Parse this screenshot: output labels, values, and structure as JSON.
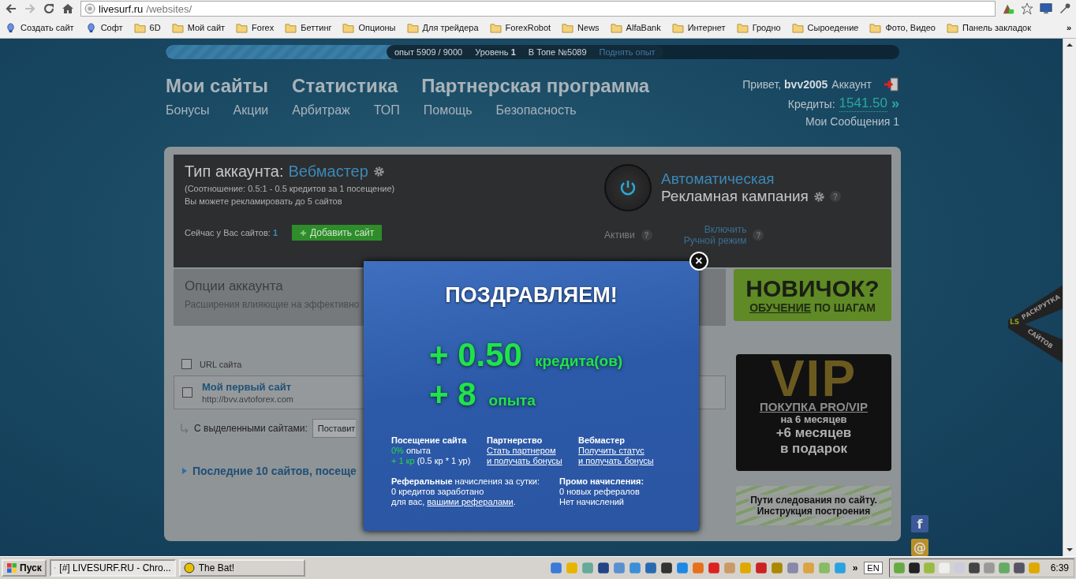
{
  "browser": {
    "url_host": "livesurf.ru",
    "url_path": "/websites/"
  },
  "bookmarks": [
    {
      "label": "Создать сайт",
      "kind": "page"
    },
    {
      "label": "Софт",
      "kind": "page"
    },
    {
      "label": "6D",
      "kind": "folder"
    },
    {
      "label": "Мой сайт",
      "kind": "folder"
    },
    {
      "label": "Forex",
      "kind": "folder"
    },
    {
      "label": "Беттинг",
      "kind": "folder"
    },
    {
      "label": "Опционы",
      "kind": "folder"
    },
    {
      "label": "Для трейдера",
      "kind": "folder"
    },
    {
      "label": "ForexRobot",
      "kind": "folder"
    },
    {
      "label": "News",
      "kind": "folder"
    },
    {
      "label": "AlfaBank",
      "kind": "folder"
    },
    {
      "label": "Интернет",
      "kind": "folder"
    },
    {
      "label": "Гродно",
      "kind": "folder"
    },
    {
      "label": "Сыроедение",
      "kind": "folder"
    },
    {
      "label": "Фото, Видео",
      "kind": "folder"
    },
    {
      "label": "Панель закладок",
      "kind": "folder"
    }
  ],
  "bookmarks_more": "»",
  "progress": {
    "level": 0.66,
    "experience": "опыт 5909 / 9000",
    "level_label": "Уровень",
    "level_value": "1",
    "rank": "В Топе №5089",
    "raise_link": "Поднять опыт"
  },
  "main_nav": [
    "Мои сайты",
    "Статистика",
    "Партнерская программа"
  ],
  "sub_nav": [
    "Бонусы",
    "Акции",
    "Арбитраж",
    "ТОП",
    "Помощь",
    "Безопасность"
  ],
  "user": {
    "greeting": "Привет,",
    "name": "bvv2005",
    "account_link": "Аккаунт",
    "credits_label": "Кредиты:",
    "credits": "1541.50",
    "credits_arrow": "»",
    "messages": "Мои Сообщения 1"
  },
  "account": {
    "type_label": "Тип аккаунта:",
    "type_value": "Вебмастер",
    "ratio": "(Соотношение: 0.5:1 - 0.5 кредитов за 1 посещение)",
    "limit": "Вы можете рекламировать до 5 сайтов",
    "sites_label": "Сейчас у Вас сайтов:",
    "sites_count": "1",
    "add_button": "Добавить сайт"
  },
  "campaign": {
    "title_1": "Автоматическая",
    "title_2": "Рекламная кампания",
    "auto_mode": "Активи",
    "manual_1": "Включить",
    "manual_2": "Ручной режим",
    "help_marks": [
      "?",
      "?",
      "?"
    ]
  },
  "options": {
    "title": "Опции аккаунта",
    "description": "Расширения влияющие на эффективно"
  },
  "sites_table": {
    "header": "URL сайта",
    "header_checked": false,
    "rows": [
      {
        "name": "Мой первый сайт",
        "url": "http://bvv.avtoforex.com",
        "checked": false
      }
    ],
    "bulk_label": "С выделенными сайтами:",
    "bulk_select": "Поставит"
  },
  "recent": "Последние 10 сайтов, посеще",
  "ads": {
    "novice_title": "НОВИЧОК?",
    "novice_sub_1": "ОБУЧЕНИЕ",
    "novice_sub_2": "ПО ШАГАМ",
    "vip_logo": "VIP",
    "vip_1": "ПОКУПКА PRO/VIP",
    "vip_2": "на 6 месяцев",
    "vip_3": "+6 месяцев",
    "vip_4": "в подарок",
    "path_1": "Пути следования по сайту.",
    "path_2": "Инструкция построения"
  },
  "ribbon": {
    "logo": "LS",
    "top": "РАСКРУТКА",
    "bottom": "САЙТОВ"
  },
  "social": [
    {
      "glyph": "f",
      "color": "#3b5998"
    },
    {
      "glyph": "@",
      "color": "#b8902a"
    }
  ],
  "modal": {
    "close": "×",
    "title": "ПОЗДРАВЛЯЕМ!",
    "rewards": [
      {
        "amount": "+ 0.50",
        "unit": "кредита(ов)"
      },
      {
        "amount": "+ 8",
        "unit": "опыта"
      }
    ],
    "visit": {
      "title": "Посещение сайта",
      "percent": "0%",
      "percent_rest": "опыта",
      "bonus": "+ 1 кр",
      "bonus_rest": "(0.5 кр * 1 ур)"
    },
    "partner": {
      "title": "Партнерство",
      "link_1": "Стать партнером",
      "link_2": "и получать бонусы"
    },
    "webmaster": {
      "title": "Вебмастер",
      "link_1": "Получить статус",
      "link_2": "и получать бонусы"
    },
    "referral": {
      "heading": "**Реферальные** начисления за сутки:",
      "line_1": "0 кредитов заработано",
      "line_2": "для вас,",
      "link": "вашими рефералами",
      "end": "."
    },
    "promo": {
      "title": "Промо начисления:",
      "line_1": "0 новых рефералов",
      "line_2": "Нет начислений"
    }
  },
  "taskbar": {
    "start": "Пуск",
    "tasks": [
      {
        "label": "[#] LIVESURF.RU - Chro...",
        "selected": true
      },
      {
        "label": "The Bat!",
        "selected": false
      }
    ],
    "tray_more": "»",
    "language": "EN",
    "time": "6:39"
  }
}
